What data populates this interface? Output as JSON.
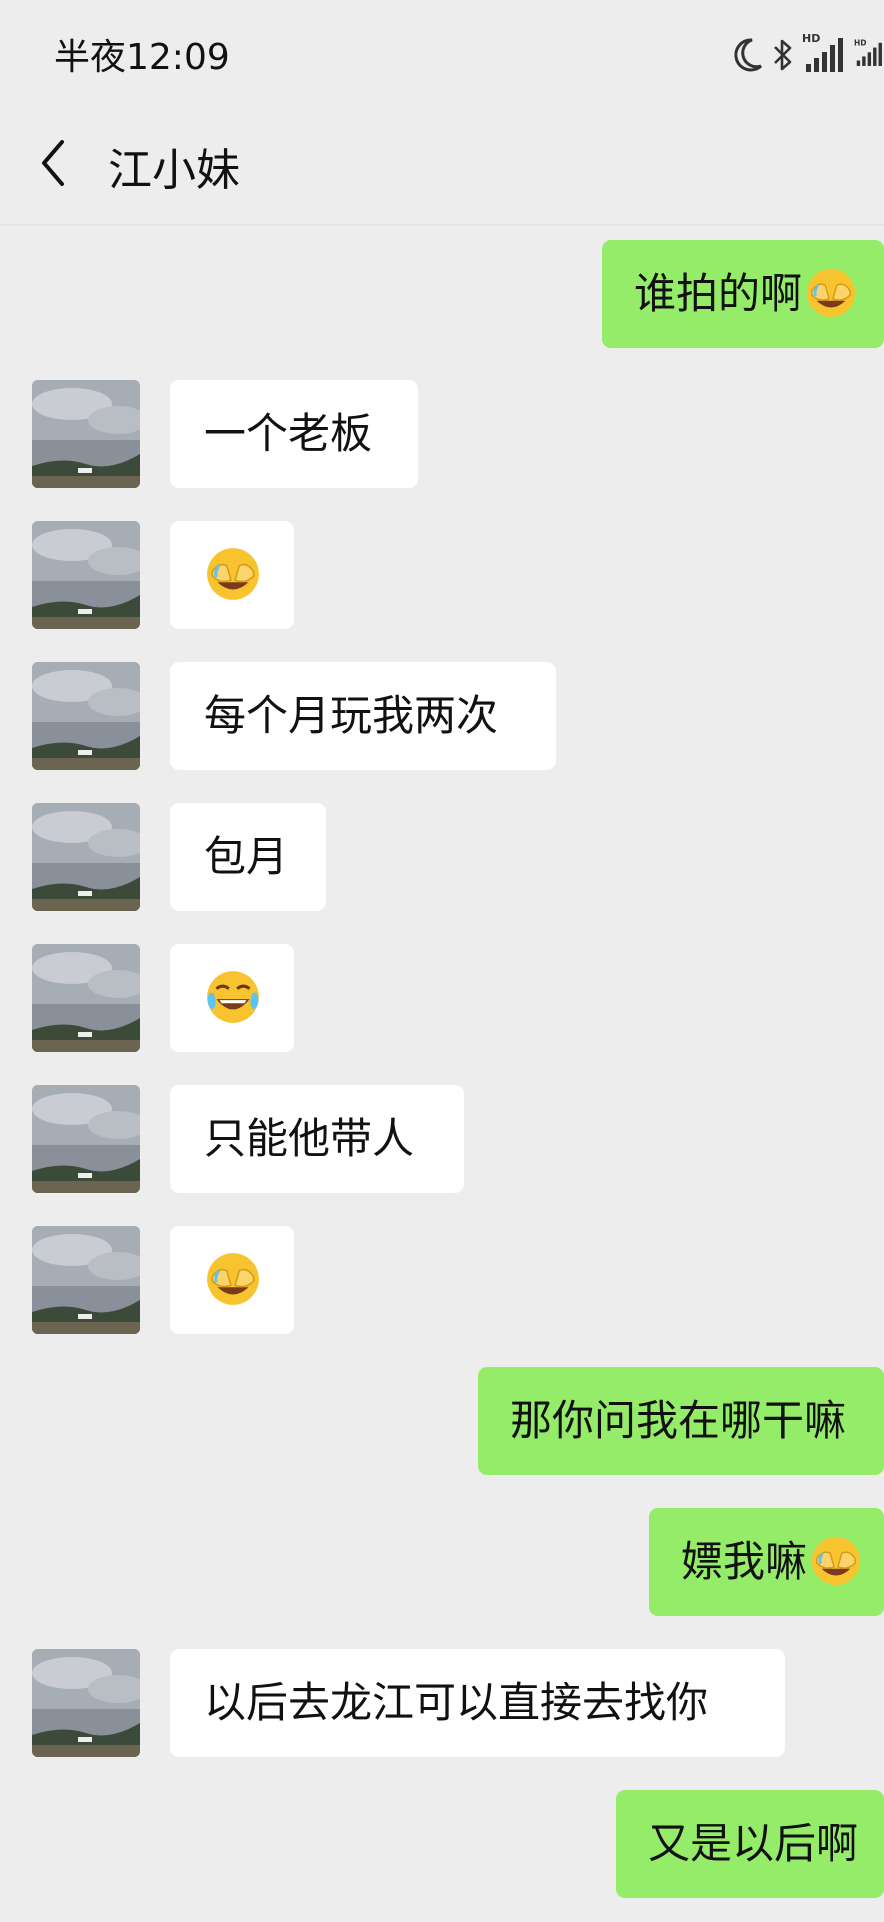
{
  "status_bar": {
    "time": "半夜12:09",
    "hd_label_1": "HD",
    "hd_label_2": "HD"
  },
  "header": {
    "title": "江小妹"
  },
  "messages": [
    {
      "side": "out",
      "text": "谁拍的啊",
      "emoji": "facepalm-laugh"
    },
    {
      "side": "in",
      "text": "一个老板"
    },
    {
      "side": "in",
      "text": "",
      "emoji": "facepalm-laugh"
    },
    {
      "side": "in",
      "text": "每个月玩我两次"
    },
    {
      "side": "in",
      "text": "包月"
    },
    {
      "side": "in",
      "text": "",
      "emoji": "tears-of-joy"
    },
    {
      "side": "in",
      "text": "只能他带人"
    },
    {
      "side": "in",
      "text": "",
      "emoji": "facepalm-laugh"
    },
    {
      "side": "out",
      "text": "那你问我在哪干嘛"
    },
    {
      "side": "out",
      "text": "嫖我嘛",
      "emoji": "facepalm-laugh"
    },
    {
      "side": "in",
      "text": "以后去龙江可以直接去找你"
    },
    {
      "side": "out",
      "text": "又是以后啊"
    }
  ],
  "colors": {
    "background": "#ededed",
    "bubble_out": "#95ec69",
    "bubble_in": "#ffffff"
  }
}
